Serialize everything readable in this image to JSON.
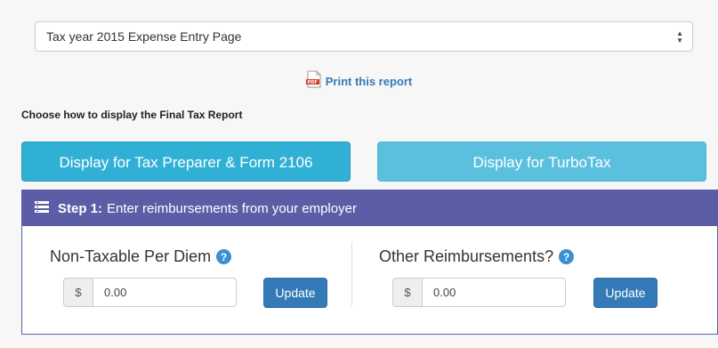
{
  "select": {
    "value": "Tax year  2015 Expense Entry Page"
  },
  "print": {
    "link_label": "Print this report",
    "icon": "pdf-icon"
  },
  "display_prompt": "Choose how to display the Final Tax Report",
  "buttons": {
    "preparer": "Display for Tax Preparer & Form 2106",
    "turbotax": "Display for TurboTax"
  },
  "step1": {
    "step_label": "Step 1:",
    "title": "Enter reimbursements from your employer",
    "per_diem": {
      "label": "Non-Taxable Per Diem",
      "currency": "$",
      "value": "0.00",
      "button": "Update"
    },
    "other": {
      "label": "Other Reimbursements?",
      "currency": "$",
      "value": "0.00",
      "button": "Update"
    },
    "help_glyph": "?"
  },
  "colors": {
    "panel_header": "#5b5ea6",
    "preparer_button": "#31b0d5",
    "turbotax_button": "#5bc0de",
    "update_button": "#337ab7",
    "link": "#337ab7"
  }
}
